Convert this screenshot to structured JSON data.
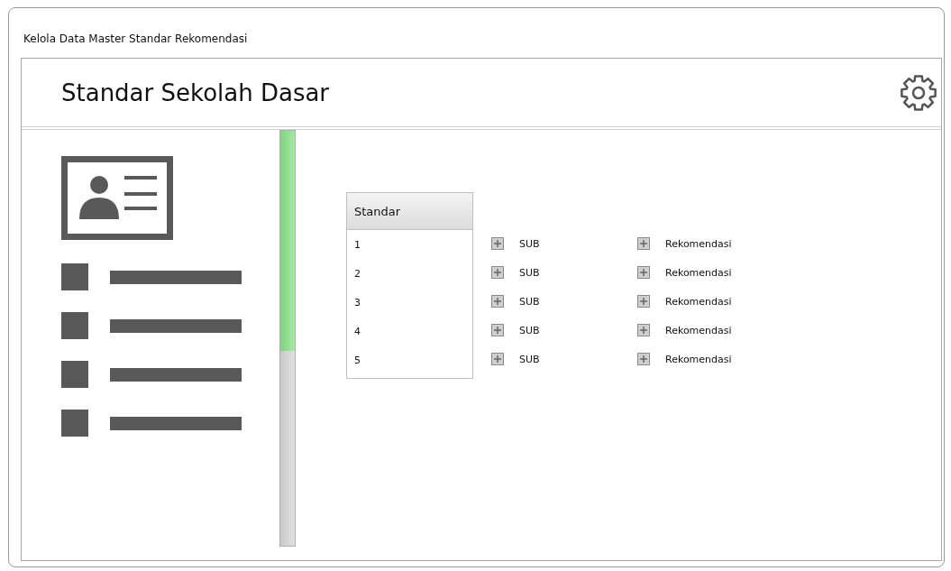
{
  "window": {
    "title": "Kelola Data Master Standar Rekomendasi"
  },
  "header": {
    "title": "Standar Sekolah Dasar"
  },
  "sidebar": {
    "menu_count_items": [
      {
        "kind": "placeholder"
      },
      {
        "kind": "placeholder"
      },
      {
        "kind": "placeholder"
      },
      {
        "kind": "placeholder"
      }
    ],
    "scroll_meter": {
      "level": 0.53
    }
  },
  "table": {
    "column": "Standar",
    "rows": [
      {
        "number": "1",
        "sub": "SUB",
        "recommendation": "Rekomendasi"
      },
      {
        "number": "2",
        "sub": "SUB",
        "recommendation": "Rekomendasi"
      },
      {
        "number": "3",
        "sub": "SUB",
        "recommendation": "Rekomendasi"
      },
      {
        "number": "4",
        "sub": "SUB",
        "recommendation": "Rekomendasi"
      },
      {
        "number": "5",
        "sub": "SUB",
        "recommendation": "Rekomendasi"
      }
    ]
  }
}
